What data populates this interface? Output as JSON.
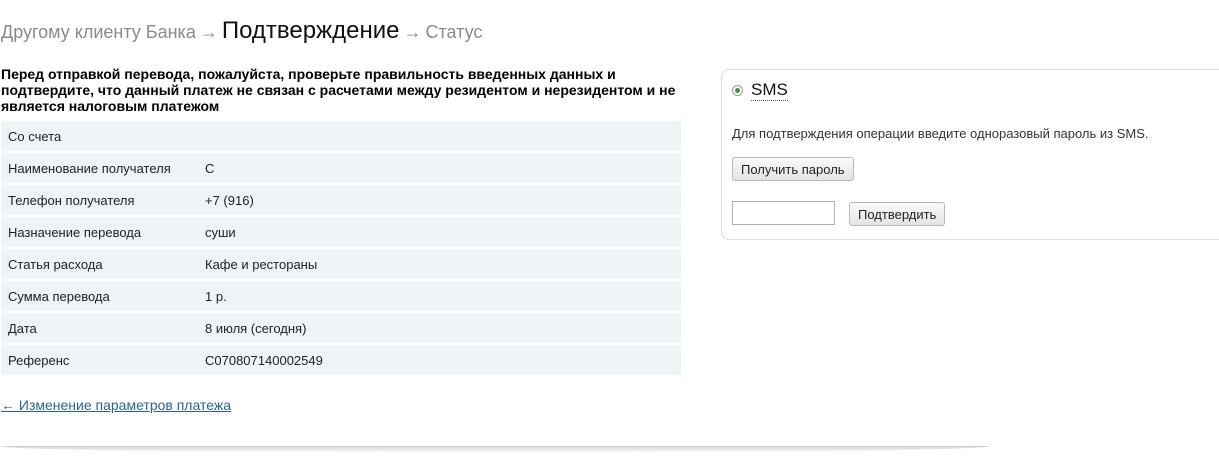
{
  "breadcrumb": {
    "step1": "Другому клиенту Банка",
    "arrow1": "→",
    "step2": "Подтверждение",
    "arrow2": "→",
    "step3": "Статус"
  },
  "notice": "Перед отправкой перевода, пожалуйста, проверьте правильность введенных данных и подтвердите, что данный платеж не связан с расчетами между резидентом и нерезидентом и не является налоговым платежом",
  "details": {
    "rows": [
      {
        "label": "Со счета",
        "value": ""
      },
      {
        "label": "Наименование получателя",
        "value": "С"
      },
      {
        "label": "Телефон получателя",
        "value": "+7 (916)"
      },
      {
        "label": "Назначение перевода",
        "value": "суши"
      },
      {
        "label": "Статья расхода",
        "value": "Кафе и рестораны"
      },
      {
        "label": "Сумма перевода",
        "value": "1 р."
      },
      {
        "label": "Дата",
        "value": "8 июля (сегодня)"
      },
      {
        "label": "Референс",
        "value": "C070807140002549"
      }
    ]
  },
  "back_link": "← Изменение параметров платежа",
  "sms": {
    "title": "SMS",
    "instruction": "Для подтверждения операции введите одноразовый пароль из SMS.",
    "get_password_label": "Получить пароль",
    "code_value": "",
    "confirm_label": "Подтвердить"
  },
  "colors": {
    "row_background": "#eef3f5",
    "link": "#2a6496",
    "radio_selected": "#3c9a2c"
  }
}
